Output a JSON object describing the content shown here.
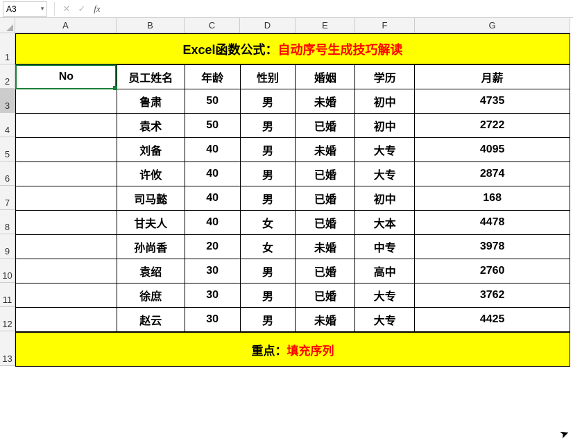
{
  "formula_bar": {
    "name_box": "A3",
    "formula_value": ""
  },
  "columns": [
    "A",
    "B",
    "C",
    "D",
    "E",
    "F",
    "G"
  ],
  "row_numbers": [
    1,
    2,
    3,
    4,
    5,
    6,
    7,
    8,
    9,
    10,
    11,
    12,
    13
  ],
  "title": {
    "black": "Excel函数公式：",
    "red": "自动序号生成技巧解读"
  },
  "headers": {
    "no": "No",
    "name": "员工姓名",
    "age": "年龄",
    "gender": "性别",
    "marriage": "婚姻",
    "edu": "学历",
    "salary": "月薪"
  },
  "rows": [
    {
      "no": "",
      "name": "鲁肃",
      "age": "50",
      "gender": "男",
      "marriage": "未婚",
      "edu": "初中",
      "salary": "4735"
    },
    {
      "no": "",
      "name": "袁术",
      "age": "50",
      "gender": "男",
      "marriage": "已婚",
      "edu": "初中",
      "salary": "2722"
    },
    {
      "no": "",
      "name": "刘备",
      "age": "40",
      "gender": "男",
      "marriage": "未婚",
      "edu": "大专",
      "salary": "4095"
    },
    {
      "no": "",
      "name": "许攸",
      "age": "40",
      "gender": "男",
      "marriage": "已婚",
      "edu": "大专",
      "salary": "2874"
    },
    {
      "no": "",
      "name": "司马懿",
      "age": "40",
      "gender": "男",
      "marriage": "已婚",
      "edu": "初中",
      "salary": "168"
    },
    {
      "no": "",
      "name": "甘夫人",
      "age": "40",
      "gender": "女",
      "marriage": "已婚",
      "edu": "大本",
      "salary": "4478"
    },
    {
      "no": "",
      "name": "孙尚香",
      "age": "20",
      "gender": "女",
      "marriage": "未婚",
      "edu": "中专",
      "salary": "3978"
    },
    {
      "no": "",
      "name": "袁绍",
      "age": "30",
      "gender": "男",
      "marriage": "已婚",
      "edu": "高中",
      "salary": "2760"
    },
    {
      "no": "",
      "name": "徐庶",
      "age": "30",
      "gender": "男",
      "marriage": "已婚",
      "edu": "大专",
      "salary": "3762"
    },
    {
      "no": "",
      "name": "赵云",
      "age": "30",
      "gender": "男",
      "marriage": "未婚",
      "edu": "大专",
      "salary": "4425"
    }
  ],
  "footer": {
    "black": "重点：",
    "red": "填充序列"
  },
  "active_cell": "A3"
}
